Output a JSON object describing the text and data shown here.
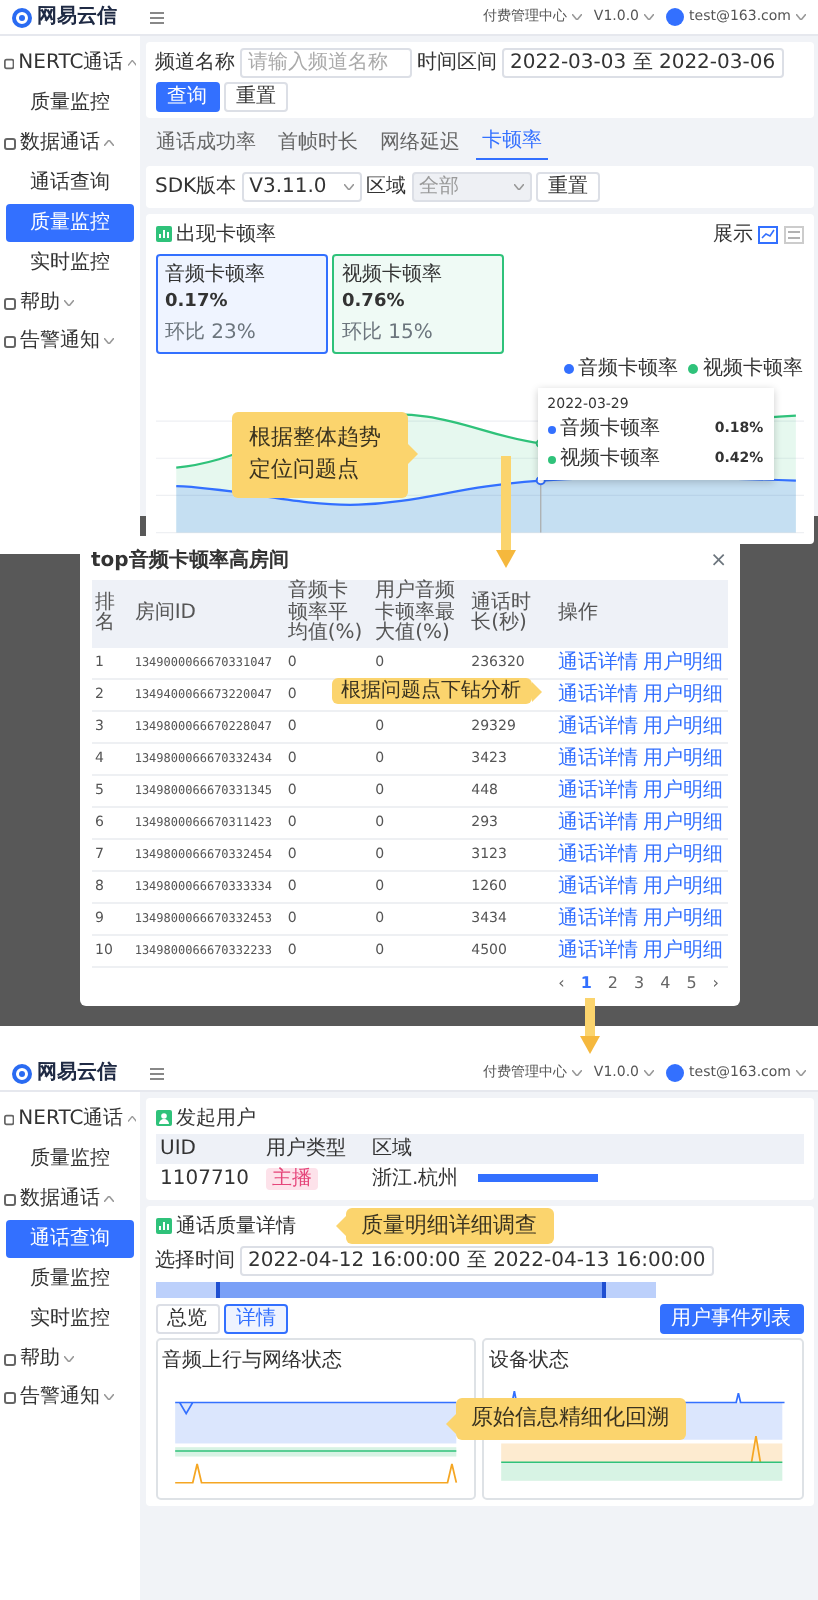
{
  "overview": {
    "topbar": {
      "logo": "网易云信",
      "items": [
        "付费管理中心",
        "V1.0.0",
        "test@163.com"
      ]
    },
    "sidebar": [
      {
        "label": "NERTC通话",
        "expanded": true,
        "children": [
          {
            "label": "质量监控",
            "selected": false
          }
        ]
      },
      {
        "label": "数据通话",
        "expanded": true,
        "children": [
          {
            "label": "通话查询",
            "selected": false
          },
          {
            "label": "质量监控",
            "selected": true
          },
          {
            "label": "实时监控",
            "selected": false
          }
        ]
      },
      {
        "label": "帮助",
        "expanded": false
      },
      {
        "label": "告警通知",
        "expanded": false
      }
    ],
    "filter": {
      "fields": [
        {
          "label": "频道名称",
          "placeholder": "请输入频道名称"
        },
        {
          "label": "时间区间",
          "value": "2022-03-03 至 2022-03-06"
        }
      ],
      "buttons": [
        "查询",
        "重置"
      ]
    },
    "tabs": [
      {
        "label": "通话成功率",
        "selected": false
      },
      {
        "label": "首帧时长",
        "selected": false
      },
      {
        "label": "网络延迟",
        "selected": false
      },
      {
        "label": "卡顿率",
        "selected": true
      }
    ],
    "filter2": {
      "fields": [
        {
          "label": "SDK版本",
          "value": "V3.11.0",
          "disabled": false
        },
        {
          "label": "区域",
          "value": "全部",
          "disabled": true
        }
      ],
      "button": "重置"
    },
    "card": {
      "title": "出现卡顿率",
      "view_label": "展示",
      "metrics": [
        {
          "title": "音频卡顿率",
          "value": "0.17%",
          "note": "环比 23%",
          "color": "#3370ff"
        },
        {
          "title": "视频卡顿率",
          "value": "0.76%",
          "note": "环比 15%",
          "color": "#2fc27a"
        }
      ],
      "legend": [
        {
          "label": "音频卡顿率",
          "color": "#3370ff"
        },
        {
          "label": "视频卡顿率",
          "color": "#2fc27a"
        }
      ],
      "tooltip": {
        "date": "2022-03-29",
        "rows": [
          {
            "label": "音频卡顿率",
            "value": "0.18%",
            "color": "#3370ff"
          },
          {
            "label": "视频卡顿率",
            "value": "0.42%",
            "color": "#2fc27a"
          }
        ]
      }
    },
    "callout": "根据整体趋势定位问题点"
  },
  "drilldown_modal": {
    "title": "top音频卡顿率高房间",
    "close": "×",
    "columns": [
      "排名",
      "房间ID",
      "音频卡顿率平均值(%)",
      "用户音频卡顿率最大值(%)",
      "通话时长(秒)",
      "操作"
    ],
    "rows": [
      {
        "rank": "1",
        "room": "1349000066670331047",
        "avg": "0",
        "max": "0",
        "duration": "236320",
        "actions": [
          "通话详情",
          "用户明细"
        ]
      },
      {
        "rank": "2",
        "room": "1349400066673220047",
        "avg": "0",
        "actions": [
          "通话详情",
          "用户明细"
        ]
      },
      {
        "rank": "3",
        "room": "1349800066670228047",
        "avg": "0",
        "max": "0",
        "duration": "29329",
        "actions": [
          "通话详情",
          "用户明细"
        ]
      },
      {
        "rank": "4",
        "room": "1349800066670332434",
        "avg": "0",
        "max": "0",
        "duration": "3423",
        "actions": [
          "通话详情",
          "用户明细"
        ]
      },
      {
        "rank": "5",
        "room": "1349800066670331345",
        "avg": "0",
        "max": "0",
        "duration": "448",
        "actions": [
          "通话详情",
          "用户明细"
        ]
      },
      {
        "rank": "6",
        "room": "1349800066670311423",
        "avg": "0",
        "max": "0",
        "duration": "293",
        "actions": [
          "通话详情",
          "用户明细"
        ]
      },
      {
        "rank": "7",
        "room": "1349800066670332454",
        "avg": "0",
        "max": "0",
        "duration": "3123",
        "actions": [
          "通话详情",
          "用户明细"
        ]
      },
      {
        "rank": "8",
        "room": "1349800066670333334",
        "avg": "0",
        "max": "0",
        "duration": "1260",
        "actions": [
          "通话详情",
          "用户明细"
        ]
      },
      {
        "rank": "9",
        "room": "1349800066670332453",
        "avg": "0",
        "max": "0",
        "duration": "3434",
        "actions": [
          "通话详情",
          "用户明细"
        ]
      },
      {
        "rank": "10",
        "room": "1349800066670332233",
        "avg": "0",
        "max": "0",
        "duration": "4500",
        "actions": [
          "通话详情",
          "用户明细"
        ]
      }
    ],
    "pagination": {
      "prev": "‹",
      "next": "›",
      "pages": [
        {
          "label": "1",
          "selected": true
        },
        {
          "label": "2",
          "selected": false
        },
        {
          "label": "3",
          "selected": false
        },
        {
          "label": "4",
          "selected": false
        },
        {
          "label": "5",
          "selected": false
        }
      ]
    },
    "callout": "根据问题点下钻分析"
  },
  "detail": {
    "topbar": {
      "logo": "网易云信",
      "items": [
        "付费管理中心",
        "V1.0.0",
        "test@163.com"
      ]
    },
    "sidebar": [
      {
        "label": "NERTC通话",
        "expanded": true,
        "children": [
          {
            "label": "质量监控",
            "selected": false
          }
        ]
      },
      {
        "label": "数据通话",
        "expanded": true,
        "children": [
          {
            "label": "通话查询",
            "selected": true
          },
          {
            "label": "质量监控",
            "selected": false
          },
          {
            "label": "实时监控",
            "selected": false
          }
        ]
      },
      {
        "label": "帮助",
        "expanded": false
      },
      {
        "label": "告警通知",
        "expanded": false
      }
    ],
    "user_table": {
      "title": "发起用户",
      "columns": [
        "UID",
        "用户类型",
        "区域"
      ],
      "row": {
        "uid": "1107710",
        "type": "主播",
        "region": "浙江.杭州"
      }
    },
    "quality": {
      "title": "通话质量详情",
      "time_label": "选择时间",
      "time_value": "2022-04-12 16:00:00 至 2022-04-13 16:00:00",
      "toggle": [
        {
          "label": "总览",
          "selected": false
        },
        {
          "label": "详情",
          "selected": true
        }
      ],
      "button": "用户事件列表",
      "charts": [
        {
          "title": "音频上行与网络状态"
        },
        {
          "title": "设备状态"
        }
      ]
    },
    "callouts": [
      "质量明细详细调查",
      "原始信息精细化回溯"
    ]
  }
}
